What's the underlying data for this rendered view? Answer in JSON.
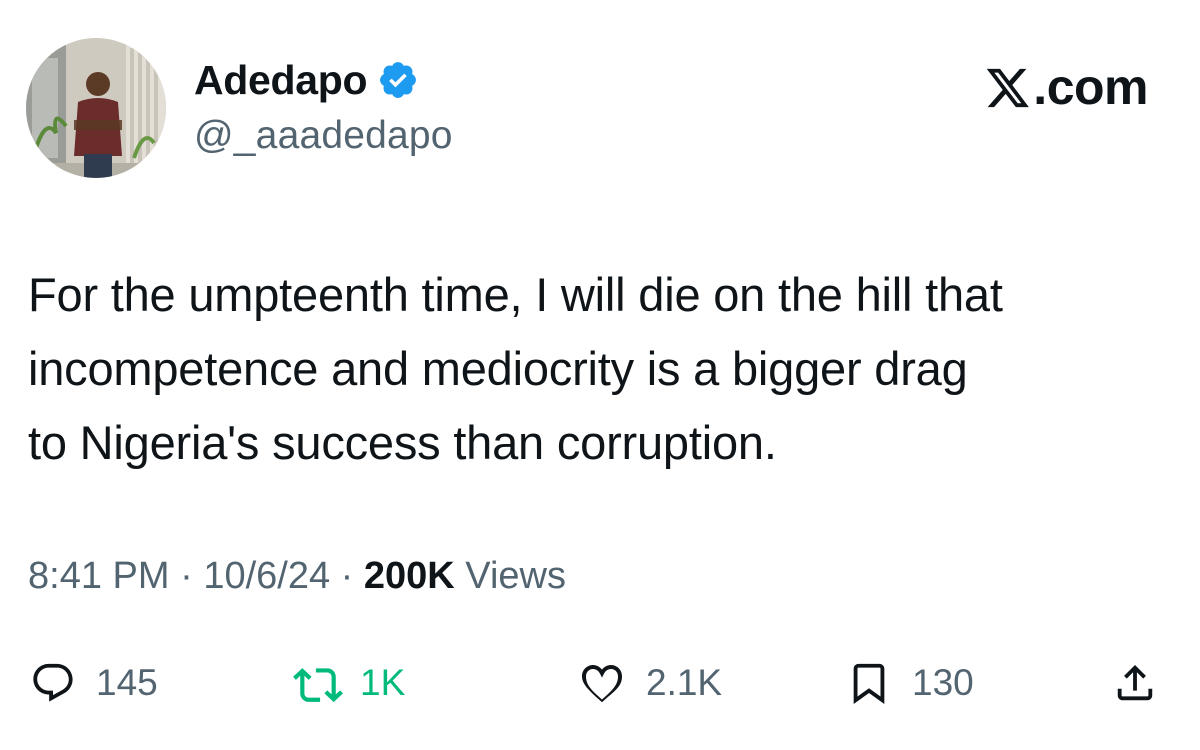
{
  "author": {
    "display_name": "Adedapo",
    "handle": "@_aaadedapo",
    "verified": true
  },
  "brand": {
    "label": ".com"
  },
  "tweet": {
    "text": "For the umpteenth time, I will die on the hill that\nincompetence and mediocrity is a bigger drag\nto Nigeria's success than corruption."
  },
  "meta": {
    "time": "8:41 PM",
    "separator": " · ",
    "date": "10/6/24",
    "views_count": "200K",
    "views_label": " Views"
  },
  "actions": {
    "replies": "145",
    "reposts": "1K",
    "likes": "2.1K",
    "bookmarks": "130"
  },
  "colors": {
    "text_primary": "#0f1419",
    "text_secondary": "#536471",
    "verified_blue": "#1d9bf0",
    "repost_green": "#00ba7c"
  },
  "icons": {
    "verified": "verified-badge-icon",
    "brand": "x-logo-icon",
    "reply": "reply-icon",
    "repost": "repost-icon",
    "like": "heart-icon",
    "bookmark": "bookmark-icon",
    "share": "share-icon"
  }
}
